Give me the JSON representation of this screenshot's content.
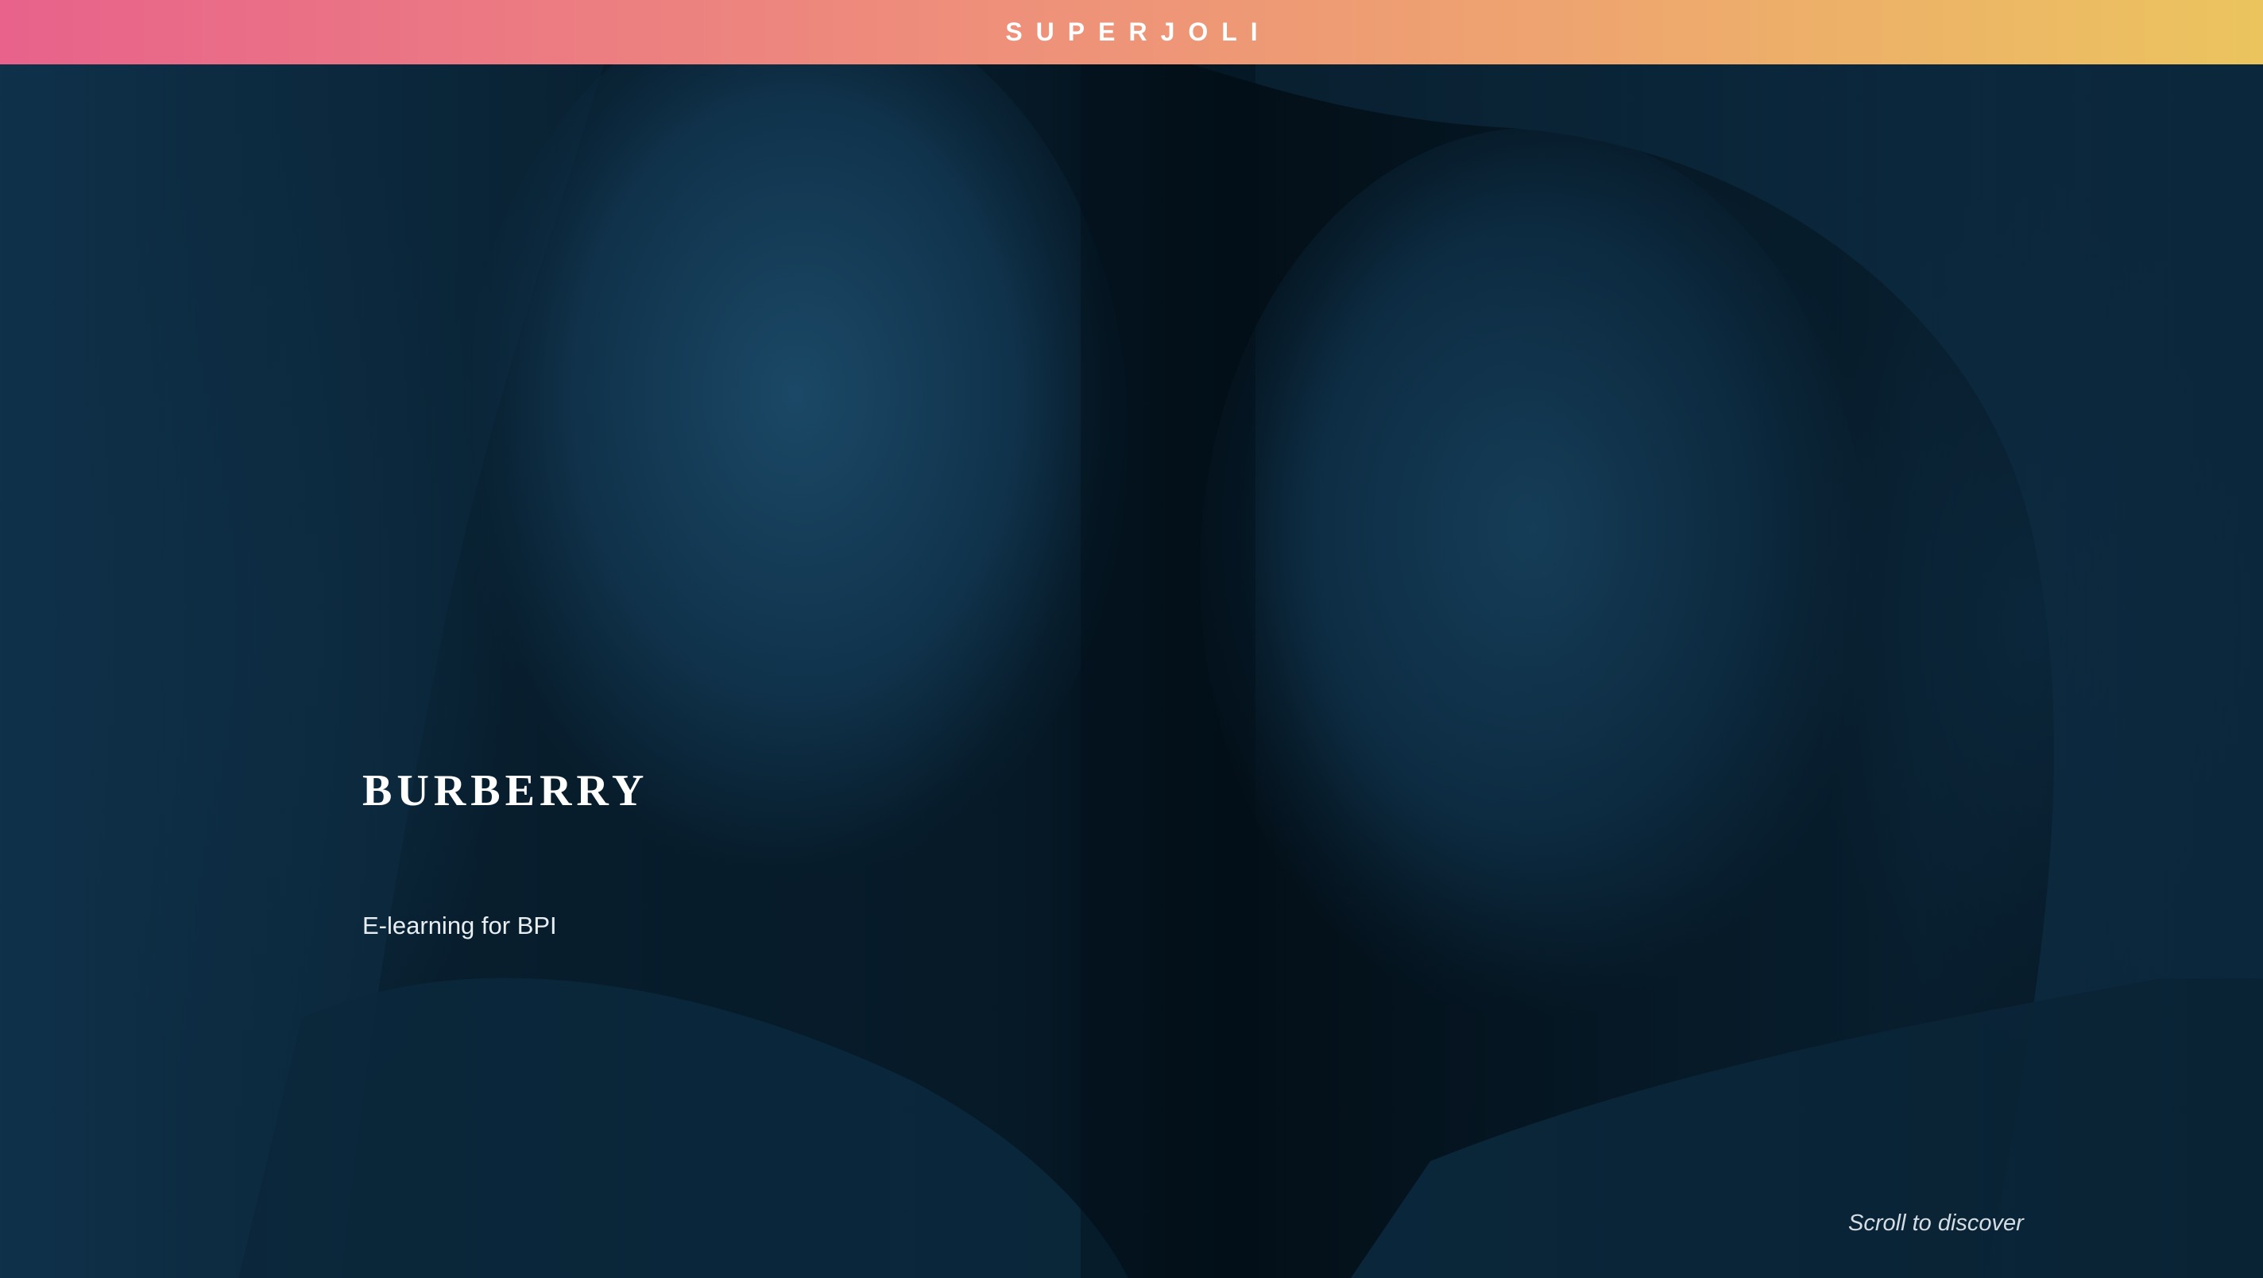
{
  "header": {
    "brand": "SUPERJOLI"
  },
  "hero": {
    "image_description_icon": "portrait-photo",
    "logo_text": "BURBERRY",
    "subtitle": "E-learning for BPI",
    "scroll_hint": "Scroll to discover"
  },
  "colors": {
    "gradient_start": "#e8628b",
    "gradient_mid": "#ee8e7b",
    "gradient_end": "#ebc45e",
    "hero_overlay": "#03121d",
    "text": "#ffffff"
  }
}
